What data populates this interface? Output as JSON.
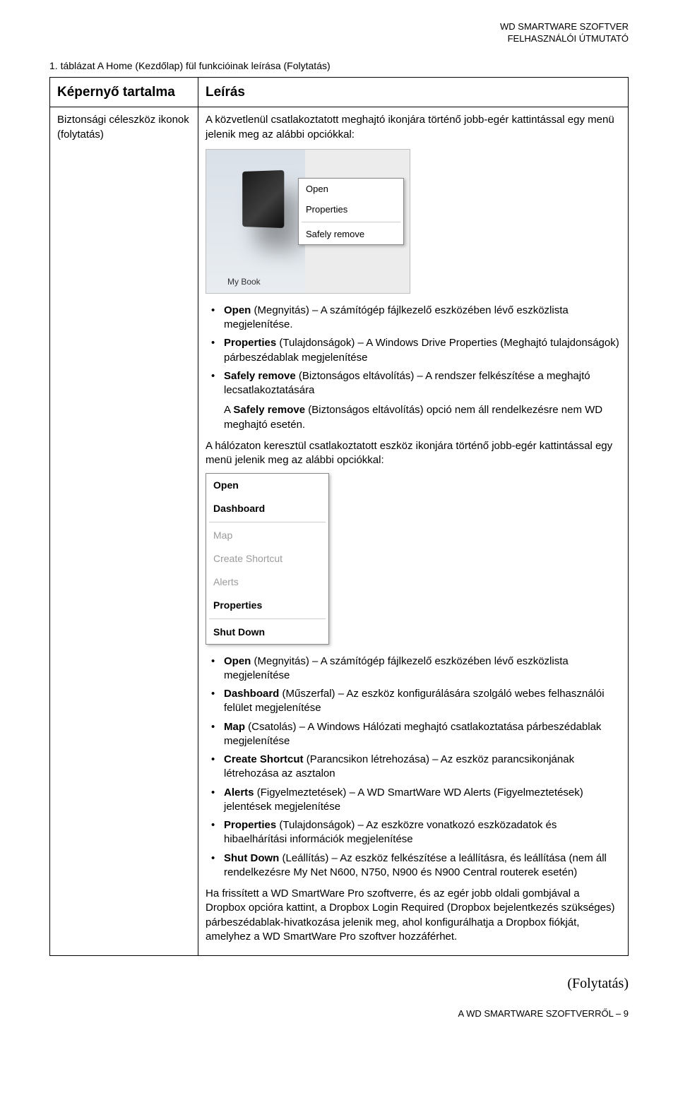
{
  "header": {
    "line1": "WD SMARTWARE SZOFTVER",
    "line2": "FELHASZNÁLÓI ÚTMUTATÓ"
  },
  "table_caption": "1. táblázat  A Home (Kezdőlap) fül funkcióinak leírása (Folytatás)",
  "table": {
    "header_left": "Képernyő tartalma",
    "header_right": "Leírás",
    "row_left": "Biztonsági céleszköz ikonok (folytatás)",
    "intro": "A közvetlenül csatlakoztatott meghajtó ikonjára történő jobb-egér kattintással egy menü jelenik meg az alábbi opciókkal:",
    "popup1": {
      "open": "Open",
      "properties": "Properties",
      "safely_remove": "Safely remove",
      "mybook": "My Book"
    },
    "list1": {
      "i1a": "Open",
      "i1b": " (Megnyitás) – A számítógép fájlkezelő eszközében lévő eszközlista megjelenítése.",
      "i2a": "Properties",
      "i2b": " (Tulajdonságok) – A Windows Drive Properties (Meghajtó tulajdonságok) párbeszédablak megjelenítése",
      "i3a": "Safely remove",
      "i3b": " (Biztonságos eltávolítás) – A rendszer felkészítése a meghajtó lecsatlakoztatására",
      "note_pre": "A ",
      "note_b": "Safely remove",
      "note_post": " (Biztonságos eltávolítás) opció nem áll rendelkezésre nem WD meghajtó esetén."
    },
    "mid_para": "A hálózaton keresztül csatlakoztatott eszköz ikonjára történő jobb-egér kattintással egy menü jelenik meg az alábbi opciókkal:",
    "popup2": {
      "open": "Open",
      "dashboard": "Dashboard",
      "map": "Map",
      "cs": "Create Shortcut",
      "alerts": "Alerts",
      "properties": "Properties",
      "shutdown": "Shut Down"
    },
    "list2": {
      "i1a": "Open",
      "i1b": " (Megnyitás) – A számítógép fájlkezelő eszközében lévő eszközlista megjelenítése",
      "i2a": "Dashboard",
      "i2b": " (Műszerfal) – Az eszköz konfigurálására szolgáló webes felhasználói felület megjelenítése",
      "i3a": "Map",
      "i3b": " (Csatolás) – A Windows Hálózati meghajtó csatlakoztatása párbeszédablak megjelenítése",
      "i4a": "Create Shortcut",
      "i4b": " (Parancsikon létrehozása) – Az eszköz parancsikonjának létrehozása az asztalon",
      "i5a": "Alerts",
      "i5b": " (Figyelmeztetések) – A WD SmartWare WD Alerts (Figyelmeztetések) jelentések megjelenítése",
      "i6a": "Properties",
      "i6b": " (Tulajdonságok) – Az eszközre vonatkozó eszközadatok és hibaelhárítási információk megjelenítése",
      "i7a": "Shut Down",
      "i7b": " (Leállítás) – Az eszköz felkészítése a leállításra, és leállítása (nem áll rendelkezésre My Net N600, N750, N900 és N900 Central routerek esetén)"
    },
    "end_para": "Ha frissített a WD SmartWare Pro szoftverre, és az egér jobb oldali gombjával a Dropbox opcióra kattint, a Dropbox Login Required (Dropbox bejelentkezés szükséges) párbeszédablak-hivatkozása jelenik meg, ahol konfigurálhatja a Dropbox fiókját, amelyhez a WD SmartWare Pro szoftver hozzáférhet."
  },
  "footer": {
    "continued": "(Folytatás)",
    "bottom": "A WD SMARTWARE SZOFTVERRŐL – 9"
  }
}
